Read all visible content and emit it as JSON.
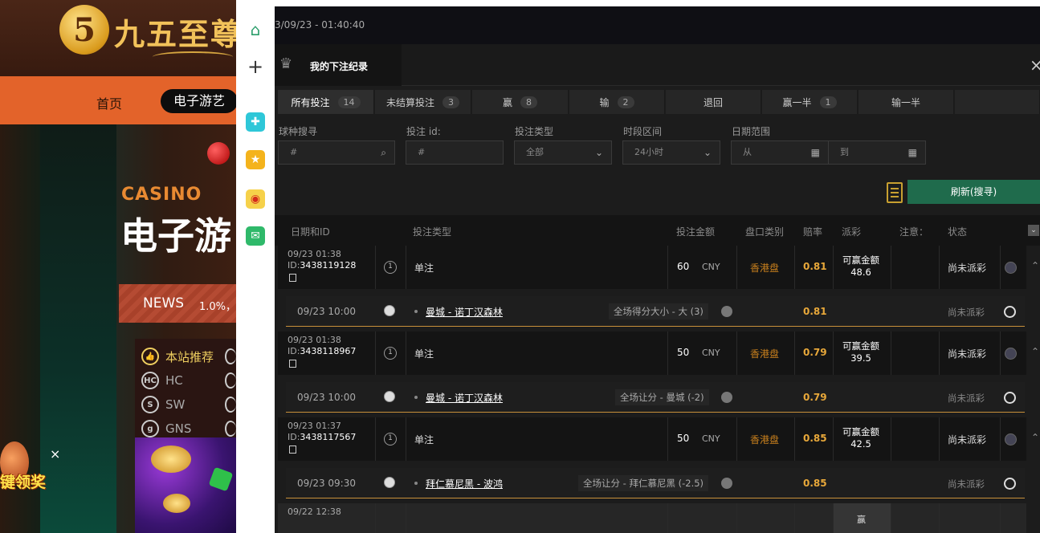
{
  "background": {
    "logo_number": "5",
    "logo_text": "九五至尊",
    "nav": {
      "home": "首页",
      "games": "电子游艺"
    },
    "casino_label": "CASINO",
    "hero_title": "电子游",
    "news_label": "NEWS",
    "news_text": "1.0%，",
    "game_menu": [
      {
        "icon": "thumb-up-icon",
        "label": "本站推荐"
      },
      {
        "icon": "hc-icon",
        "label": "HC"
      },
      {
        "icon": "sw-icon",
        "label": "SW"
      },
      {
        "icon": "gns-icon",
        "label": "GNS"
      }
    ],
    "promo_text": "键领奖",
    "promo_close": "×"
  },
  "sidebar": {
    "items": [
      {
        "icon": "home-icon",
        "glyph": "⌂"
      },
      {
        "icon": "plus-icon",
        "glyph": "+"
      },
      {
        "icon": "app-icon",
        "glyph": "✚"
      },
      {
        "icon": "favorite-star-icon",
        "glyph": "★"
      },
      {
        "icon": "weibo-icon",
        "glyph": "◉"
      },
      {
        "icon": "mail-icon",
        "glyph": "✉"
      }
    ]
  },
  "topbar": {
    "datetime": "3/09/23 - 01:40:40"
  },
  "modal": {
    "title": "我的下注纪录",
    "close": "×",
    "tabs": [
      {
        "label": "所有投注",
        "count": "14"
      },
      {
        "label": "未结算投注",
        "count": "3"
      },
      {
        "label": "赢",
        "count": "8"
      },
      {
        "label": "输",
        "count": "2"
      },
      {
        "label": "退回",
        "count": ""
      },
      {
        "label": "赢一半",
        "count": "1"
      },
      {
        "label": "输一半",
        "count": ""
      },
      {
        "label": "",
        "count": ""
      }
    ],
    "filters": {
      "sport_search": {
        "label": "球种搜寻",
        "placeholder": "#"
      },
      "bet_id": {
        "label": "投注 id:",
        "placeholder": "#"
      },
      "bet_type": {
        "label": "投注类型",
        "value": "全部"
      },
      "period": {
        "label": "时段区间",
        "value": "24小时"
      },
      "date_range": {
        "label": "日期范围",
        "from": "从",
        "to": "到"
      }
    },
    "refresh_label": "刷新(搜寻)",
    "columns": {
      "date_id": "日期和ID",
      "bet_type": "投注类型",
      "amount": "投注金额",
      "odds_type": "盘口类别",
      "odds": "赔率",
      "payout": "派彩",
      "note": "注意：",
      "status": "状态"
    },
    "bets": [
      {
        "date": "09/23 01:38",
        "id": "3438119128",
        "type": "单注",
        "amount": "60",
        "currency": "CNY",
        "odds_type": "香港盘",
        "odds": "0.81",
        "payout_label": "可赢金额",
        "payout": "48.6",
        "status": "尚未派彩",
        "selection": {
          "date": "09/23 10:00",
          "match": "曼城 - 诺丁汉森林",
          "market": "全场得分大小 - 大 (3)",
          "odds": "0.81",
          "status": "尚未派彩"
        }
      },
      {
        "date": "09/23 01:38",
        "id": "3438118967",
        "type": "单注",
        "amount": "50",
        "currency": "CNY",
        "odds_type": "香港盘",
        "odds": "0.79",
        "payout_label": "可赢金额",
        "payout": "39.5",
        "status": "尚未派彩",
        "selection": {
          "date": "09/23 10:00",
          "match": "曼城 - 诺丁汉森林",
          "market": "全场让分 - 曼城 (-2)",
          "odds": "0.79",
          "status": "尚未派彩"
        }
      },
      {
        "date": "09/23 01:37",
        "id": "3438117567",
        "type": "单注",
        "amount": "50",
        "currency": "CNY",
        "odds_type": "香港盘",
        "odds": "0.85",
        "payout_label": "可赢金额",
        "payout": "42.5",
        "status": "尚未派彩",
        "selection": {
          "date": "09/23 09:30",
          "match": "拜仁慕尼黑 - 波鸿",
          "market": "全场让分 - 拜仁慕尼黑 (-2.5)",
          "odds": "0.85",
          "status": "尚未派彩"
        }
      }
    ],
    "partial_row": {
      "date": "09/22 12:38",
      "payout": "赢"
    },
    "id_prefix": "ID:"
  }
}
